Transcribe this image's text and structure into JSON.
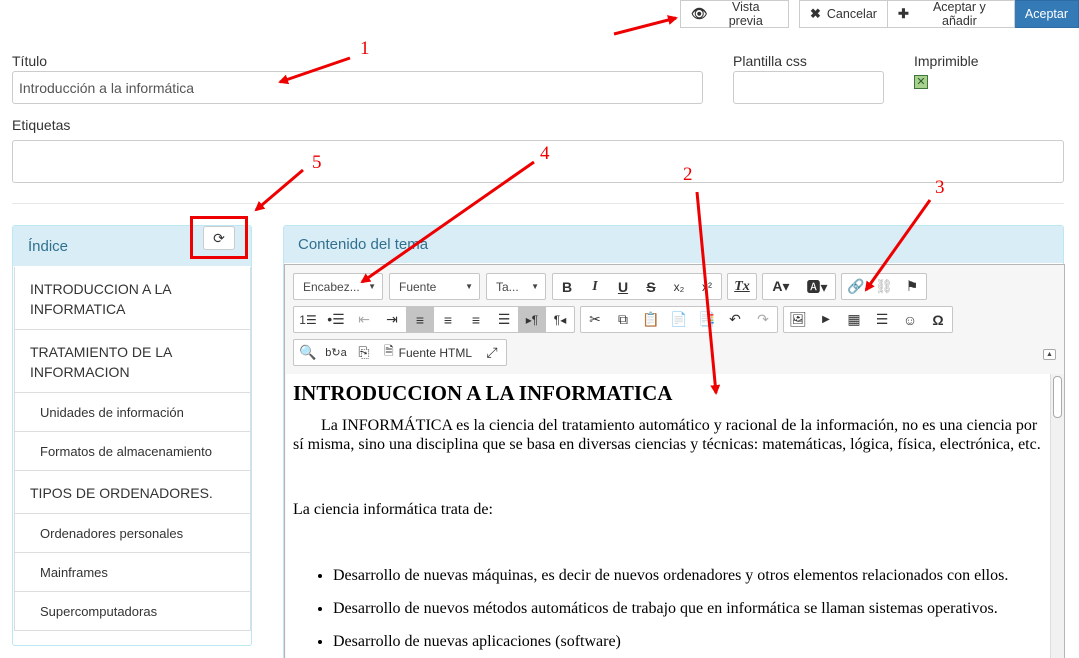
{
  "toolbar": {
    "preview_label": "Vista previa",
    "cancel_label": "Cancelar",
    "accept_add_label": "Aceptar y añadir",
    "accept_label": "Aceptar"
  },
  "form": {
    "title_label": "Título",
    "title_value": "Introducción a la informática",
    "css_label": "Plantilla css",
    "css_value": "",
    "printable_label": "Imprimible",
    "printable_checked": true,
    "tags_label": "Etiquetas",
    "tags_value": ""
  },
  "index": {
    "title": "Índice",
    "items": [
      {
        "label": "INTRODUCCION A LA INFORMATICA",
        "level": 1
      },
      {
        "label": "TRATAMIENTO DE LA INFORMACION",
        "level": 1
      },
      {
        "label": "Unidades de información",
        "level": 2
      },
      {
        "label": "Formatos de almacenamiento",
        "level": 2
      },
      {
        "label": "TIPOS DE ORDENADORES.",
        "level": 1
      },
      {
        "label": "Ordenadores personales",
        "level": 2
      },
      {
        "label": "Mainframes",
        "level": 2
      },
      {
        "label": "Supercomputadoras",
        "level": 2
      }
    ]
  },
  "editor": {
    "panel_title": "Contenido del tema",
    "heading_combo": "Encabez...",
    "font_combo": "Fuente",
    "size_combo": "Ta...",
    "source_label": "Fuente HTML",
    "content": {
      "heading": "INTRODUCCION A LA INFORMATICA",
      "para1": "La INFORMÁTICA es la ciencia del tratamiento automático y racional de la información, no es una ciencia por sí misma, sino una disciplina que se basa en diversas ciencias y técnicas: matemáticas, lógica, física, electrónica, etc.",
      "para2": "La ciencia informática trata de:",
      "bullets": [
        "Desarrollo de nuevas máquinas, es decir de nuevos ordenadores y otros elementos relacionados con ellos.",
        "Desarrollo de nuevos métodos automáticos de trabajo que en informática se llaman sistemas operativos.",
        "Desarrollo de nuevas aplicaciones (software)"
      ]
    }
  },
  "annotations": {
    "n1": "1",
    "n2": "2",
    "n3": "3",
    "n4": "4",
    "n5": "5",
    "color": "#e00000"
  },
  "icons": [
    "eye-icon",
    "close-icon",
    "plus-icon",
    "refresh-icon"
  ]
}
